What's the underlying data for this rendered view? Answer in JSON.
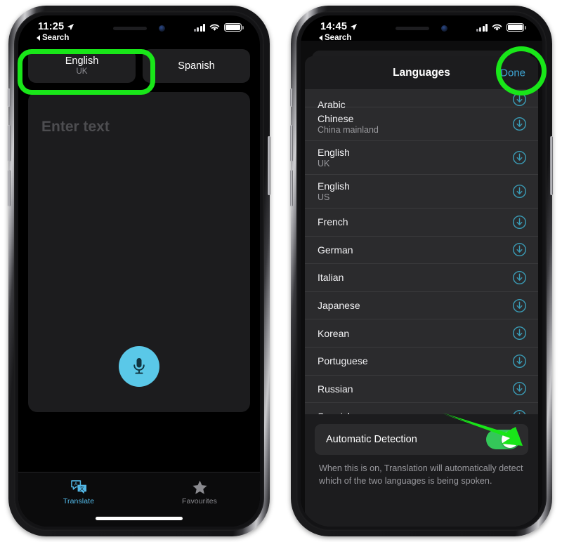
{
  "page": {
    "description": "Two iPhone screenshots side by side showing the iOS Translate app with green annotation highlights"
  },
  "left_phone": {
    "status_bar": {
      "time": "11:25",
      "back_label": "Search",
      "location_icon": "location-arrow-icon",
      "signal_icon": "cellular-signal-icon",
      "wifi_icon": "wifi-icon",
      "battery_icon": "battery-full-icon"
    },
    "language_pills": [
      {
        "name": "English",
        "region": "UK",
        "highlighted": true
      },
      {
        "name": "Spanish",
        "region": "",
        "highlighted": false
      }
    ],
    "text_entry": {
      "placeholder": "Enter text",
      "mic_icon": "microphone-icon"
    },
    "tab_bar": [
      {
        "label": "Translate",
        "icon": "translate-bubbles-icon",
        "active": true
      },
      {
        "label": "Favourites",
        "icon": "star-icon",
        "active": false
      }
    ]
  },
  "right_phone": {
    "status_bar": {
      "time": "14:45",
      "back_label": "Search",
      "location_icon": "location-arrow-icon",
      "signal_icon": "cellular-signal-icon",
      "wifi_icon": "wifi-icon",
      "battery_icon": "battery-full-icon"
    },
    "sheet": {
      "title": "Languages",
      "done_label": "Done",
      "done_highlighted": true
    },
    "languages": [
      {
        "name": "Arabic",
        "region": "",
        "download_icon": "download-circle-icon",
        "clipped": true
      },
      {
        "name": "Chinese",
        "region": "China mainland",
        "download_icon": "download-circle-icon",
        "clipped": false
      },
      {
        "name": "English",
        "region": "UK",
        "download_icon": "download-circle-icon",
        "clipped": false
      },
      {
        "name": "English",
        "region": "US",
        "download_icon": "download-circle-icon",
        "clipped": false
      },
      {
        "name": "French",
        "region": "",
        "download_icon": "download-circle-icon",
        "clipped": false
      },
      {
        "name": "German",
        "region": "",
        "download_icon": "download-circle-icon",
        "clipped": false
      },
      {
        "name": "Italian",
        "region": "",
        "download_icon": "download-circle-icon",
        "clipped": false
      },
      {
        "name": "Japanese",
        "region": "",
        "download_icon": "download-circle-icon",
        "clipped": false
      },
      {
        "name": "Korean",
        "region": "",
        "download_icon": "download-circle-icon",
        "clipped": false
      },
      {
        "name": "Portuguese",
        "region": "",
        "download_icon": "download-circle-icon",
        "clipped": false
      },
      {
        "name": "Russian",
        "region": "",
        "download_icon": "download-circle-icon",
        "clipped": false
      },
      {
        "name": "Spanish",
        "region": "",
        "download_icon": "download-circle-icon",
        "clipped": false
      }
    ],
    "automatic_detection": {
      "label": "Automatic Detection",
      "toggle_state": "on",
      "footer": "When this is on, Translation will automatically detect which of the two languages is being spoken."
    }
  },
  "annotations": {
    "highlight_color": "#19e619",
    "rect_target": "english-uk-language-pill",
    "circle_target": "done-button",
    "arrow_target": "automatic-detection-toggle"
  },
  "colors": {
    "accent_blue": "#3ea5d4",
    "mic_blue": "#5ac8e8",
    "download_teal": "#3a9bb5",
    "toggle_green": "#34c759",
    "annotation_green": "#19e619",
    "screen_black": "#000000",
    "card_gray": "#1c1c1e",
    "list_gray": "#2b2b2d"
  }
}
